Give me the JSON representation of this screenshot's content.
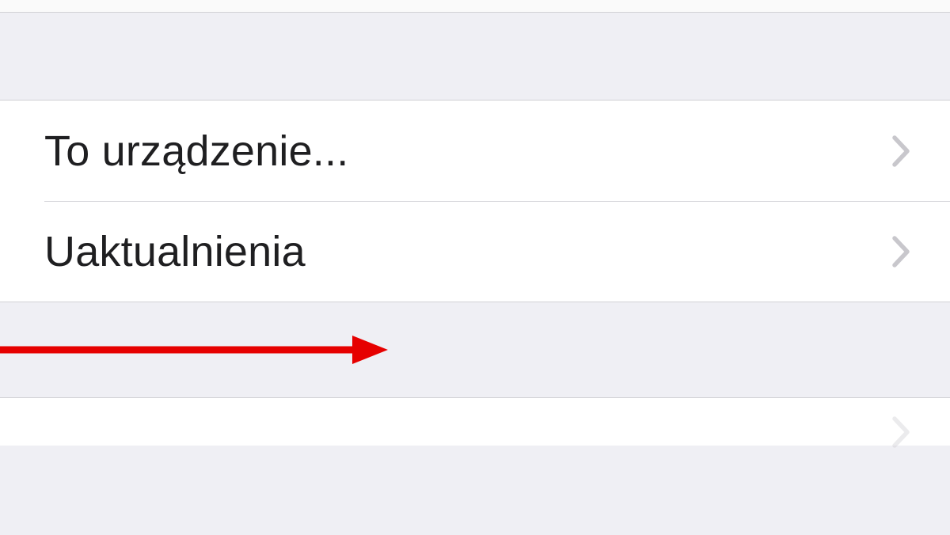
{
  "items": {
    "device": {
      "label": "To urządzenie..."
    },
    "updates": {
      "label": "Uaktualnienia"
    }
  },
  "annotation": {
    "color": "#e60000"
  }
}
